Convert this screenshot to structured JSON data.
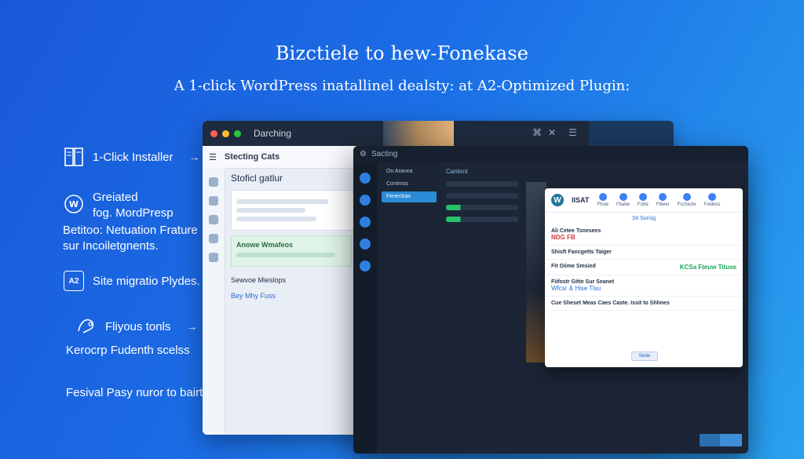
{
  "hero": {
    "title": "Bizctiele to hew-Fonekase",
    "subtitle": "A 1-click WordPress inatallinel dealsty: at A2-Optimized Plugin:"
  },
  "features": [
    {
      "icon": "document-icon",
      "text": "1-Click Installer",
      "arrow": "→"
    },
    {
      "icon": "wordpress-icon",
      "text": "Greiated\nfog. MordPresp"
    },
    {
      "icon": "",
      "text": "Betitoo: Netuation Frature\nsur Incoiletgnents."
    },
    {
      "icon": "a2-badge-icon",
      "badge": "A2",
      "text": "Site migratio Plydes."
    },
    {
      "icon": "hand-icon",
      "text": "Fliyous tonls",
      "arrow": "→"
    },
    {
      "icon": "",
      "text": "Kerocrp Fudenth scelss"
    },
    {
      "icon": "",
      "text": "Fesival Pasy nuror to bairt"
    }
  ],
  "back_window": {
    "title": "Darching",
    "app_title": "Stecting Cats",
    "section_title": "Stoficl gatlur",
    "green_title": "Anowe Wmafeos",
    "lower_title": "Sewvoe Mieslops",
    "lower_item": "Bey Mhy Fuss"
  },
  "front_window": {
    "title": "Sacting",
    "nav_header": "On Aranea",
    "nav_items": [
      "Contmos",
      "Fenectrax"
    ],
    "mid_title": "Cantent"
  },
  "modal": {
    "title": "IISAT",
    "tabs": [
      "Fhsie",
      "Fbabe",
      "Fotte",
      "Flbeer",
      "Fschicite",
      "Foldess"
    ],
    "section": "Sit Surisg",
    "rows": [
      {
        "title": "Ali Cetee Tsnesees",
        "tag": "NDG FB",
        "tag_type": "red"
      },
      {
        "title": "Shisft Fancgetts Taiger",
        "tag": "",
        "tag_type": ""
      },
      {
        "title": "Fit Oiime Smsied",
        "tag": "KCSa Fteuw Tituse",
        "tag_type": "green"
      },
      {
        "title": "Fiifostr Gitte Sur Seanet",
        "tag": "Wfcsr & Hise Tisu",
        "tag_type": "blue"
      },
      {
        "title": "Cue Sheset Meas Caes Caste. Issit to Shhnes",
        "tag": "",
        "tag_type": ""
      }
    ],
    "button": "Sinlie"
  },
  "colors": {
    "bg_start": "#1a58d8",
    "bg_end": "#2aa2ef",
    "accent": "#2b8bd8",
    "success": "#1aa55a",
    "danger": "#d23a3a"
  }
}
